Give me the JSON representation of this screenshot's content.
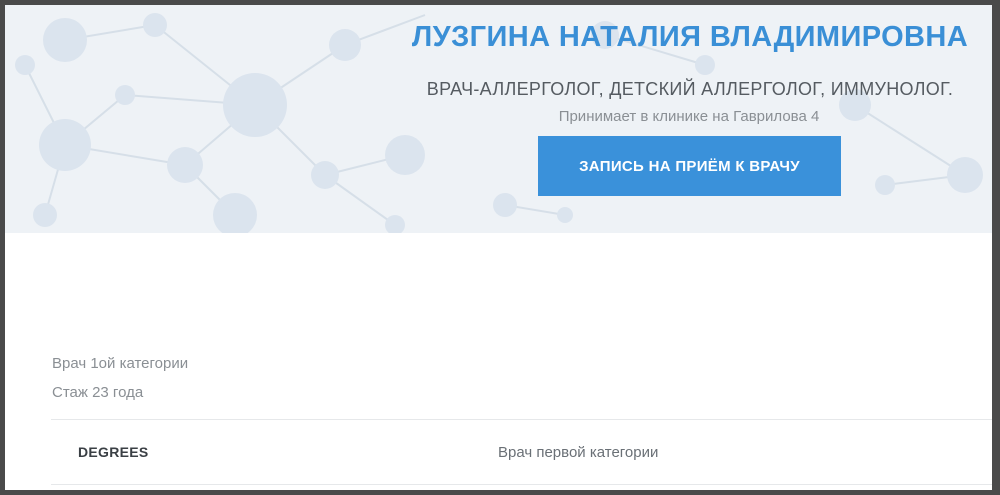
{
  "header": {
    "name": "ЛУЗГИНА НАТАЛИЯ ВЛАДИМИРОВНА",
    "specialties": "ВРАЧ-АЛЛЕРГОЛОГ, ДЕТСКИЙ АЛЛЕРГОЛОГ, ИММУНОЛОГ.",
    "clinic": "Принимает в клинике на Гаврилова 4",
    "book_button": "ЗАПИСЬ НА ПРИЁМ К ВРАЧУ"
  },
  "info": {
    "category": "Врач 1ой категории",
    "experience": "Стаж 23 года"
  },
  "details": [
    {
      "label": "DEGREES",
      "value": "Врач первой категории"
    }
  ],
  "colors": {
    "accent": "#3a91da",
    "name_color": "#3a8fd6",
    "hero_background": "#eef2f6"
  }
}
